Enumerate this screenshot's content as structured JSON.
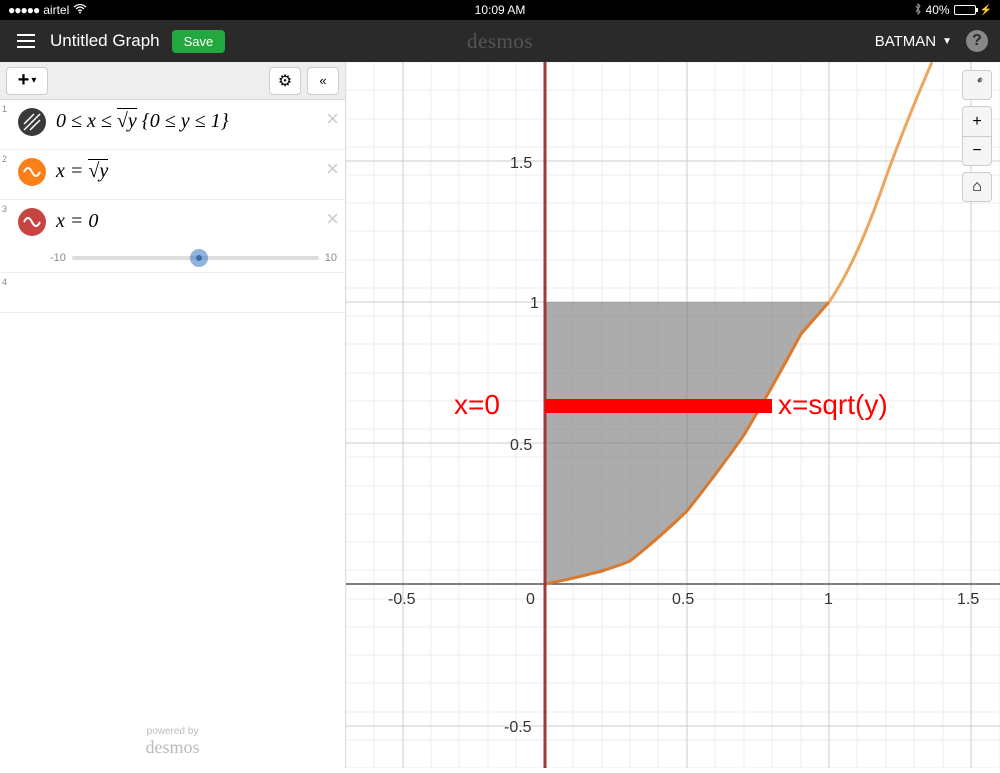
{
  "status_bar": {
    "carrier": "airtel",
    "signal_dots": "●●●●●",
    "time": "10:09 AM",
    "battery_pct": "40%",
    "battery_fill": 40
  },
  "header": {
    "title": "Untitled Graph",
    "save_label": "Save",
    "logo": "desmos",
    "user": "BATMAN",
    "help": "?"
  },
  "sidebar": {
    "add_glyph": "+▾",
    "gear_glyph": "⚙",
    "collapse_glyph": "«",
    "expressions": [
      {
        "num": "1",
        "formula_html": "0 ≤ <i>x</i> ≤ √<i>y</i> {0 ≤ <i>y</i> ≤ 1}"
      },
      {
        "num": "2",
        "formula_html": "<i>x</i> = √<i>y</i>"
      },
      {
        "num": "3",
        "formula_html": "<i>x</i> = 0",
        "slider": {
          "min": "-10",
          "max": "10"
        }
      }
    ],
    "empty_num": "4",
    "footer_label": "powered by",
    "footer_logo": "desmos"
  },
  "graph_controls": {
    "wrench": "🔧",
    "plus": "+",
    "minus": "−",
    "home": "⌂"
  },
  "chart_data": {
    "type": "area",
    "title": "",
    "xlabel": "",
    "ylabel": "",
    "xlim": [
      -0.7,
      1.6
    ],
    "ylim": [
      -0.65,
      1.85
    ],
    "x_ticks": [
      -0.5,
      0,
      0.5,
      1,
      1.5
    ],
    "y_ticks": [
      -0.5,
      0.5,
      1,
      1.5
    ],
    "minor_grid_step": 0.1,
    "series": [
      {
        "name": "x = sqrt(y)",
        "type": "line",
        "color": "#e08a3a",
        "equation": "x = sqrt(y)",
        "points_xy": [
          [
            0,
            0
          ],
          [
            0.2,
            0.04
          ],
          [
            0.4,
            0.16
          ],
          [
            0.6,
            0.36
          ],
          [
            0.8,
            0.64
          ],
          [
            1.0,
            1.0
          ],
          [
            1.2,
            1.44
          ],
          [
            1.36,
            1.85
          ]
        ]
      },
      {
        "name": "x = 0",
        "type": "vline",
        "color": "#9c3a3a",
        "x": 0
      },
      {
        "name": "region 0<=x<=sqrt(y), 0<=y<=1",
        "type": "area",
        "color": "#808080",
        "alpha": 0.65,
        "boundary_xy": [
          [
            0,
            0
          ],
          [
            0.2,
            0.04
          ],
          [
            0.4,
            0.16
          ],
          [
            0.6,
            0.36
          ],
          [
            0.8,
            0.64
          ],
          [
            1.0,
            1.0
          ],
          [
            0,
            1.0
          ]
        ]
      }
    ],
    "annotations": [
      {
        "text": "x=0",
        "x": -0.3,
        "y": 0.65,
        "color": "#f00"
      },
      {
        "text": "x=sqrt(y)",
        "x": 1.2,
        "y": 0.65,
        "color": "#f00"
      },
      {
        "type": "hline_segment",
        "y": 0.63,
        "x0": 0,
        "x1": 0.8,
        "color": "#f00",
        "width": 12
      }
    ]
  }
}
